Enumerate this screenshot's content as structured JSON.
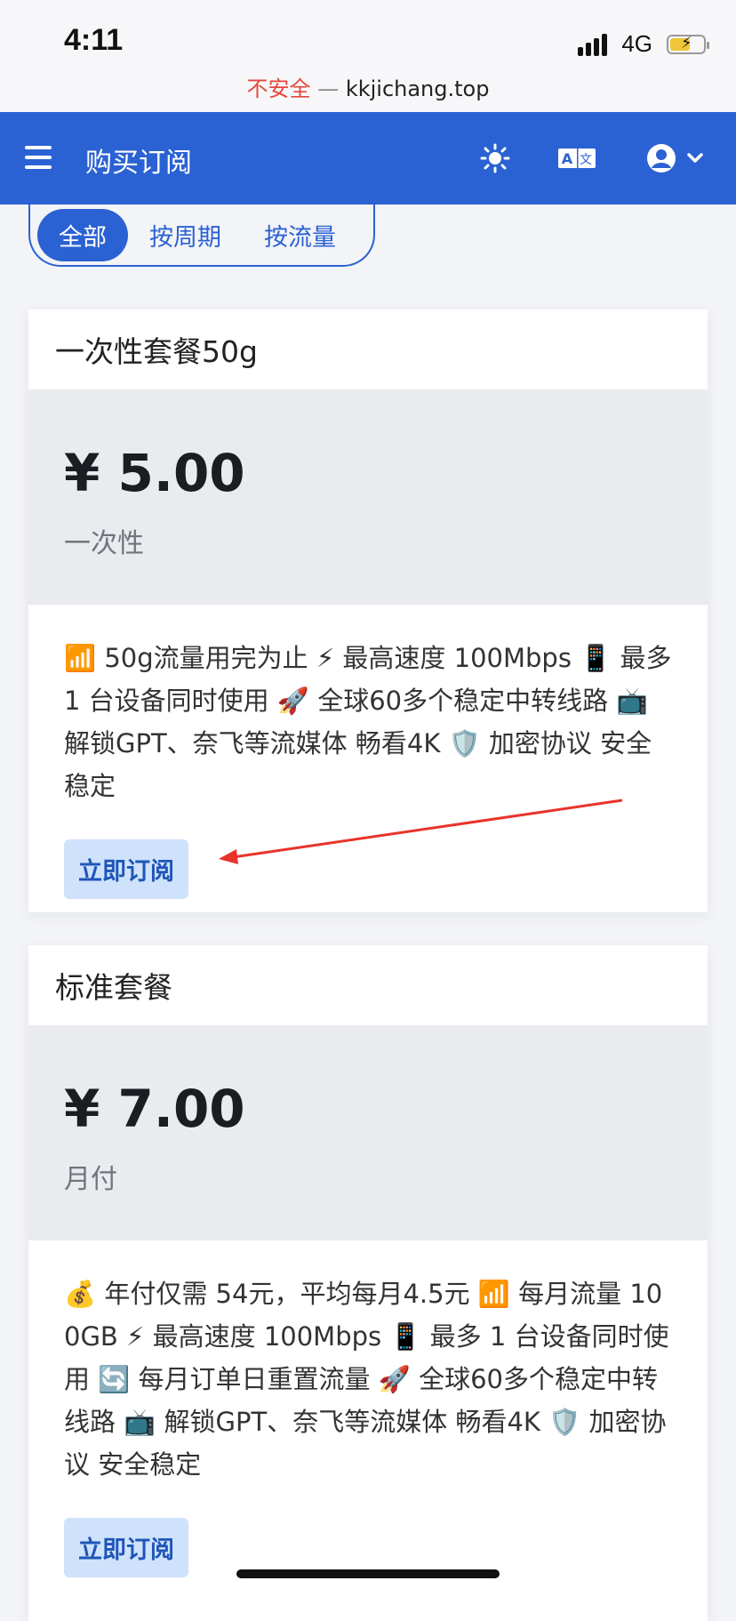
{
  "status": {
    "time": "4:11",
    "network": "4G"
  },
  "browser": {
    "insecure": "不安全",
    "separator": "—",
    "domain": "kkjichang.top"
  },
  "header": {
    "title": "购买订阅"
  },
  "tabs": [
    "全部",
    "按周期",
    "按流量"
  ],
  "plans": [
    {
      "title": "一次性套餐50g",
      "price": "¥ 5.00",
      "period": "一次性",
      "description": "📶 50g流量用完为止 ⚡ 最高速度 100Mbps 📱 最多 1 台设备同时使用 🚀 全球60多个稳定中转线路 📺 解锁GPT、奈飞等流媒体 畅看4K 🛡️ 加密协议 安全稳定",
      "button": "立即订阅"
    },
    {
      "title": "标准套餐",
      "price": "¥ 7.00",
      "period": "月付",
      "description": "💰 年付仅需 54元，平均每月4.5元 📶 每月流量 100GB ⚡ 最高速度 100Mbps 📱 最多 1 台设备同时使用 🔄 每月订单日重置流量 🚀 全球60多个稳定中转线路 📺 解锁GPT、奈飞等流媒体 畅看4K 🛡️ 加密协议 安全稳定",
      "button": "立即订阅"
    }
  ],
  "colors": {
    "primary": "#2b62d3",
    "insecure": "#e5473c",
    "button_bg": "#cfe2fb",
    "annotation_arrow": "#e8332a"
  },
  "icons": [
    "menu-icon",
    "theme-sun-icon",
    "translate-icon",
    "user-avatar-icon",
    "chevron-down-icon"
  ]
}
